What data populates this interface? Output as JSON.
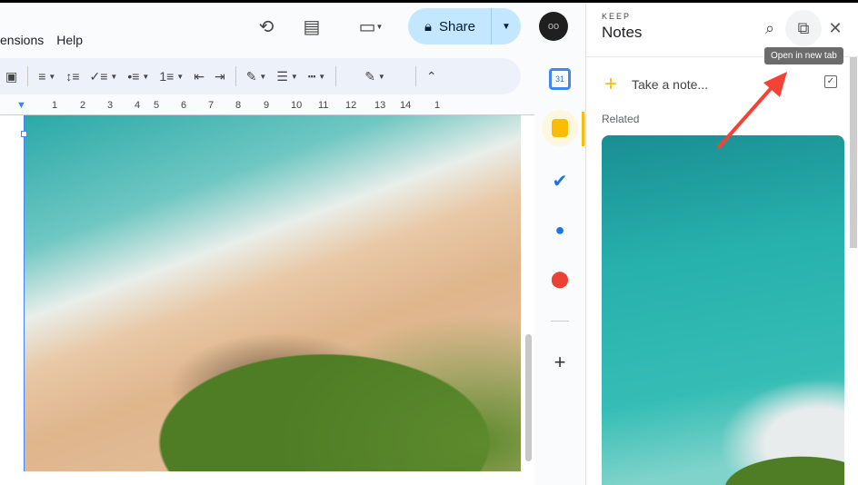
{
  "menu": [
    "ensions",
    "Help"
  ],
  "header": {
    "share_label": "Share",
    "avatar_initials": "oo"
  },
  "ruler": [
    "1",
    "2",
    "3",
    "4",
    "5",
    "6",
    "7",
    "8",
    "9",
    "10",
    "11",
    "12",
    "13",
    "14",
    "1"
  ],
  "keep": {
    "brand": "KEEP",
    "title": "Notes",
    "tooltip": "Open in new tab",
    "take_note": "Take a note...",
    "related": "Related"
  },
  "colors": {
    "share_bg": "#c2e7ff",
    "accent": "#fbbc04",
    "arrow": "#f44336"
  }
}
